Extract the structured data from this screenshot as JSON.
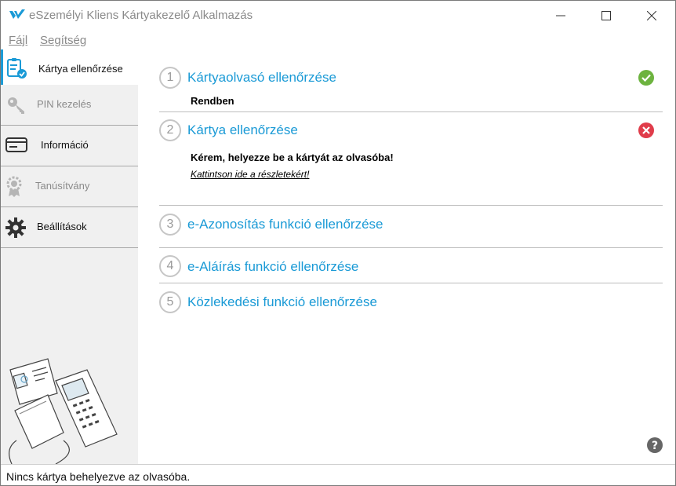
{
  "window": {
    "title": "eSzemélyi Kliens Kártyakezelő Alkalmazás",
    "brand_color": "#1a9ad6"
  },
  "menu": {
    "file": "Fájl",
    "help": "Segítség"
  },
  "sidebar": {
    "items": [
      {
        "label": "Kártya ellenőrzése",
        "icon": "card-check-icon",
        "active": true
      },
      {
        "label": "PIN kezelés",
        "icon": "key-icon",
        "active": false
      },
      {
        "label": "Információ",
        "icon": "card-icon",
        "active": false
      },
      {
        "label": "Tanúsítvány",
        "icon": "certificate-icon",
        "active": false
      },
      {
        "label": "Beállítások",
        "icon": "gear-icon",
        "active": false
      }
    ]
  },
  "steps": [
    {
      "number": "1",
      "title": "Kártyaolvasó ellenőrzése",
      "status": "ok",
      "status_color": "#6db33f",
      "detail": "Rendben"
    },
    {
      "number": "2",
      "title": "Kártya ellenőrzése",
      "status": "error",
      "status_color": "#e03c4a",
      "detail": "Kérem, helyezze be a kártyát az olvasóba!",
      "link": "Kattintson ide a részletekért!"
    },
    {
      "number": "3",
      "title": "e-Azonosítás funkció ellenőrzése"
    },
    {
      "number": "4",
      "title": "e-Aláírás funkció ellenőrzése"
    },
    {
      "number": "5",
      "title": "Közlekedési funkció ellenőrzése"
    }
  ],
  "statusbar": {
    "text": "Nincs kártya behelyezve az olvasóba."
  }
}
